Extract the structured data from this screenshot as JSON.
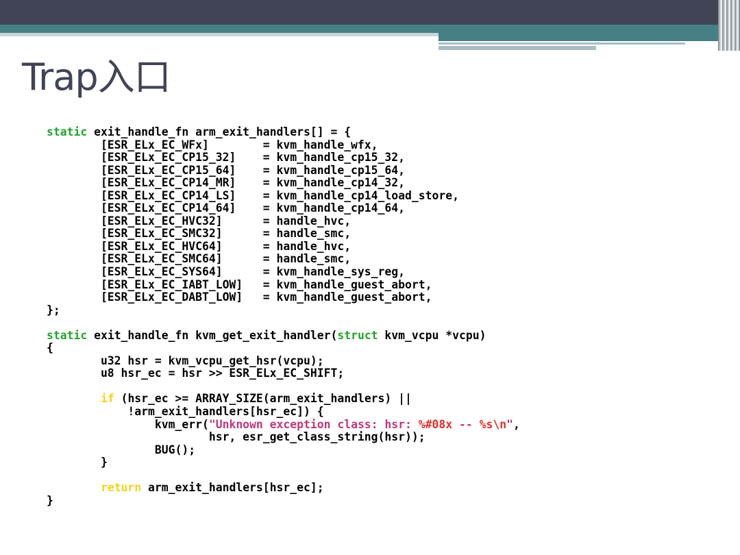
{
  "slide": {
    "title": "Trap入口"
  },
  "code": {
    "lines": [
      [
        {
          "t": "static",
          "c": "kw"
        },
        {
          "t": " exit_handle_fn arm_exit_handlers[] = {",
          "c": "t"
        }
      ],
      [
        {
          "t": "        [ESR_ELx_EC_WFx]        = kvm_handle_wfx,",
          "c": "t"
        }
      ],
      [
        {
          "t": "        [ESR_ELx_EC_CP15_32]    = kvm_handle_cp15_32,",
          "c": "t"
        }
      ],
      [
        {
          "t": "        [ESR_ELx_EC_CP15_64]    = kvm_handle_cp15_64,",
          "c": "t"
        }
      ],
      [
        {
          "t": "        [ESR_ELx_EC_CP14_MR]    = kvm_handle_cp14_32,",
          "c": "t"
        }
      ],
      [
        {
          "t": "        [ESR_ELx_EC_CP14_LS]    = kvm_handle_cp14_load_store,",
          "c": "t"
        }
      ],
      [
        {
          "t": "        [ESR_ELx_EC_CP14_64]    = kvm_handle_cp14_64,",
          "c": "t"
        }
      ],
      [
        {
          "t": "        [ESR_ELx_EC_HVC32]      = handle_hvc,",
          "c": "t"
        }
      ],
      [
        {
          "t": "        [ESR_ELx_EC_SMC32]      = handle_smc,",
          "c": "t"
        }
      ],
      [
        {
          "t": "        [ESR_ELx_EC_HVC64]      = handle_hvc,",
          "c": "t"
        }
      ],
      [
        {
          "t": "        [ESR_ELx_EC_SMC64]      = handle_smc,",
          "c": "t"
        }
      ],
      [
        {
          "t": "        [ESR_ELx_EC_SYS64]      = kvm_handle_sys_reg,",
          "c": "t"
        }
      ],
      [
        {
          "t": "        [ESR_ELx_EC_IABT_LOW]   = kvm_handle_guest_abort,",
          "c": "t"
        }
      ],
      [
        {
          "t": "        [ESR_ELx_EC_DABT_LOW]   = kvm_handle_guest_abort,",
          "c": "t"
        }
      ],
      [
        {
          "t": "};",
          "c": "t"
        }
      ],
      [
        {
          "t": "",
          "c": "t"
        }
      ],
      [
        {
          "t": "static",
          "c": "kw"
        },
        {
          "t": " exit_handle_fn kvm_get_exit_handler(",
          "c": "t"
        },
        {
          "t": "struct",
          "c": "kw"
        },
        {
          "t": " kvm_vcpu *vcpu)",
          "c": "t"
        }
      ],
      [
        {
          "t": "{",
          "c": "t"
        }
      ],
      [
        {
          "t": "        u32 hsr = kvm_vcpu_get_hsr(vcpu);",
          "c": "t"
        }
      ],
      [
        {
          "t": "        u8 hsr_ec = hsr >> ESR_ELx_EC_SHIFT;",
          "c": "t"
        }
      ],
      [
        {
          "t": "",
          "c": "t"
        }
      ],
      [
        {
          "t": "        ",
          "c": "t"
        },
        {
          "t": "if",
          "c": "kw2"
        },
        {
          "t": " (hsr_ec >= ARRAY_SIZE(arm_exit_handlers) ||",
          "c": "t"
        }
      ],
      [
        {
          "t": "            !arm_exit_handlers[hsr_ec]) {",
          "c": "t"
        }
      ],
      [
        {
          "t": "                kvm_err(",
          "c": "t"
        },
        {
          "t": "\"Unknown exception class: hsr: ",
          "c": "str"
        },
        {
          "t": "%#08x",
          "c": "fmt"
        },
        {
          "t": " -- ",
          "c": "str"
        },
        {
          "t": "%s\\n",
          "c": "fmt"
        },
        {
          "t": "\"",
          "c": "str"
        },
        {
          "t": ",",
          "c": "t"
        }
      ],
      [
        {
          "t": "                        hsr, esr_get_class_string(hsr));",
          "c": "t"
        }
      ],
      [
        {
          "t": "                BUG();",
          "c": "t"
        }
      ],
      [
        {
          "t": "        }",
          "c": "t"
        }
      ],
      [
        {
          "t": "",
          "c": "t"
        }
      ],
      [
        {
          "t": "        ",
          "c": "t"
        },
        {
          "t": "return",
          "c": "kw2"
        },
        {
          "t": " arm_exit_handlers[hsr_ec];",
          "c": "t"
        }
      ],
      [
        {
          "t": "}",
          "c": "t"
        }
      ]
    ]
  }
}
